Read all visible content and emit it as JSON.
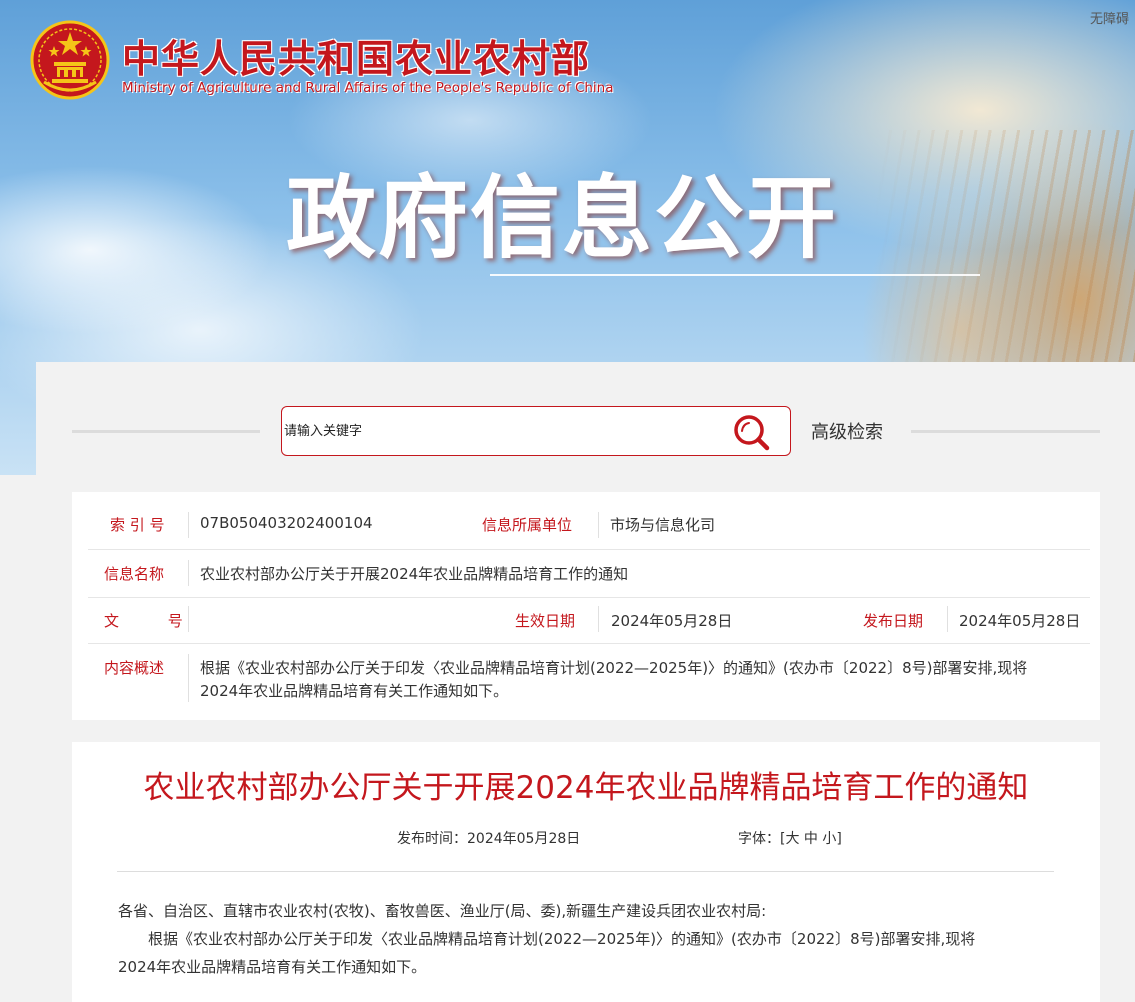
{
  "header": {
    "accessibility_link": "无障碍",
    "ministry_cn": "中华人民共和国农业农村部",
    "ministry_en": "Ministry of Agriculture and Rural Affairs of the People's Republic of China",
    "banner_title": "政府信息公开"
  },
  "search": {
    "placeholder": "请输入关键字",
    "advanced_label": "高级检索"
  },
  "meta": {
    "index_label": "索 引 号",
    "index_value": "07B050403202400104",
    "dept_label": "信息所属单位",
    "dept_value": "市场与信息化司",
    "name_label": "信息名称",
    "name_value": "农业农村部办公厅关于开展2024年农业品牌精品培育工作的通知",
    "doc_no_label": "文 号",
    "effective_label": "生效日期",
    "effective_value": "2024年05月28日",
    "publish_label": "发布日期",
    "publish_value": "2024年05月28日",
    "summary_label": "内容概述",
    "summary_line1": "根据《农业农村部办公厅关于印发〈农业品牌精品培育计划(2022—2025年)〉的通知》(农办市〔2022〕8号)部署安排,现将",
    "summary_line2": "2024年农业品牌精品培育有关工作通知如下。"
  },
  "article": {
    "title": "农业农村部办公厅关于开展2024年农业品牌精品培育工作的通知",
    "publish_time": "发布时间：2024年05月28日",
    "font_label": "字体：",
    "font_open": "[",
    "font_large": "大",
    "font_medium": "中",
    "font_small": "小",
    "font_close": "]",
    "salutation": "各省、自治区、直辖市农业农村(农牧)、畜牧兽医、渔业厅(局、委),新疆生产建设兵团农业农村局:",
    "para1_line1": "根据《农业农村部办公厅关于印发〈农业品牌精品培育计划(2022—2025年)〉的通知》(农办市〔2022〕8号)部署安排,现将",
    "para1_line2": "2024年农业品牌精品培育有关工作通知如下。"
  },
  "colors": {
    "brand_red": "#c4171d",
    "emblem_gold": "#f5c518"
  }
}
